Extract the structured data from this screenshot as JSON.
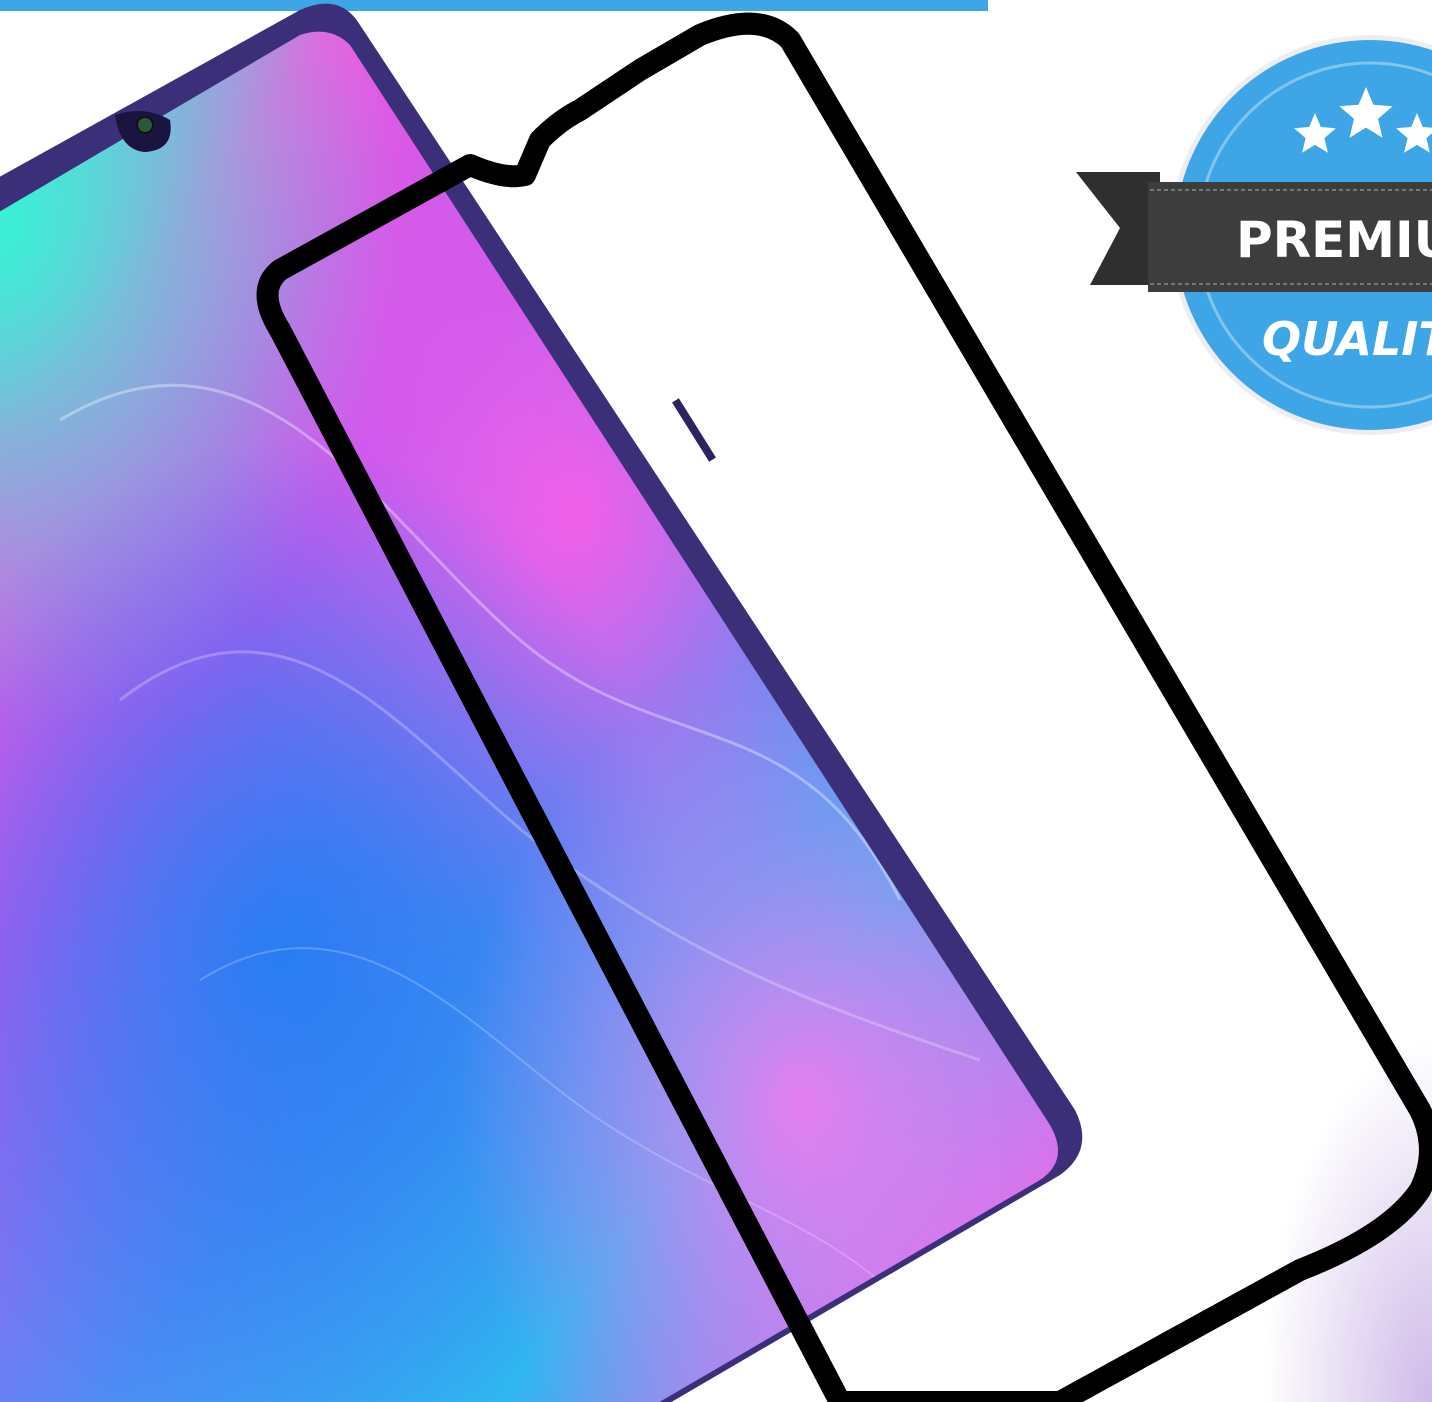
{
  "image": {
    "subject": "phone-screen-protector-product-photo",
    "accent_color": "#3ea6e6",
    "phone_frame_color": "#3b2f7a",
    "protector_border_color": "#000000"
  },
  "badge": {
    "top_text": "PREMIU",
    "bottom_text": "QUALIT",
    "stars": 3,
    "circle_color": "#3ea6e6",
    "ribbon_color": "#3d3d3d",
    "text_color": "#ffffff"
  }
}
